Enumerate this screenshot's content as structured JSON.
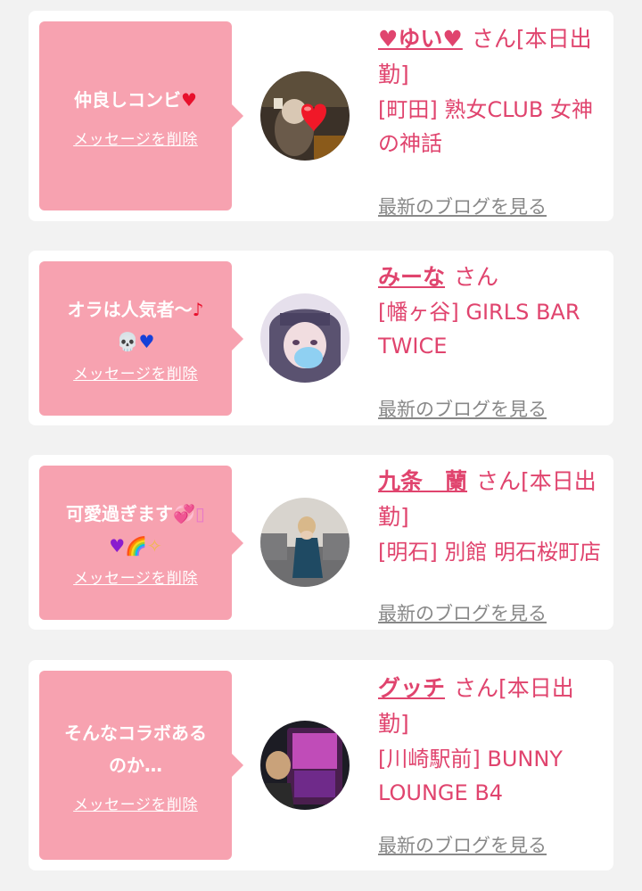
{
  "cards": [
    {
      "bubble": {
        "line1": "仲良しコンビ",
        "emoji1": "♥",
        "line2": "",
        "emoji2": ""
      },
      "delete_label": "メッセージを削除",
      "name": "♥ゆい♥",
      "san": "さん",
      "status": "[本日出勤]",
      "shop": "[町田] 熟女CLUB 女神の神話",
      "blog_label": "最新のブログを見る"
    },
    {
      "bubble": {
        "line1": "オラは人気者〜",
        "emoji1": "♪",
        "line2": "💀",
        "emoji2": "♥"
      },
      "delete_label": "メッセージを削除",
      "name": "みーな",
      "san": "さん",
      "status": "",
      "shop": "[幡ヶ谷] GIRLS BAR TWICE",
      "blog_label": "最新のブログを見る"
    },
    {
      "bubble": {
        "line1": "可愛過ぎます",
        "emoji1": "💞▯",
        "line2": "♥🌈",
        "emoji2": "✧"
      },
      "delete_label": "メッセージを削除",
      "name": "九条　蘭",
      "san": "さん",
      "status": "[本日出勤]",
      "shop": "[明石] 別館 明石桜町店",
      "blog_label": "最新のブログを見る"
    },
    {
      "bubble": {
        "line1": "そんなコラボある",
        "emoji1": "",
        "line2": "のか…",
        "emoji2": ""
      },
      "delete_label": "メッセージを削除",
      "name": "グッチ",
      "san": "さん",
      "status": "[本日出勤]",
      "shop": "[川崎駅前] BUNNY LOUNGE B4",
      "blog_label": "最新のブログを見る"
    }
  ]
}
